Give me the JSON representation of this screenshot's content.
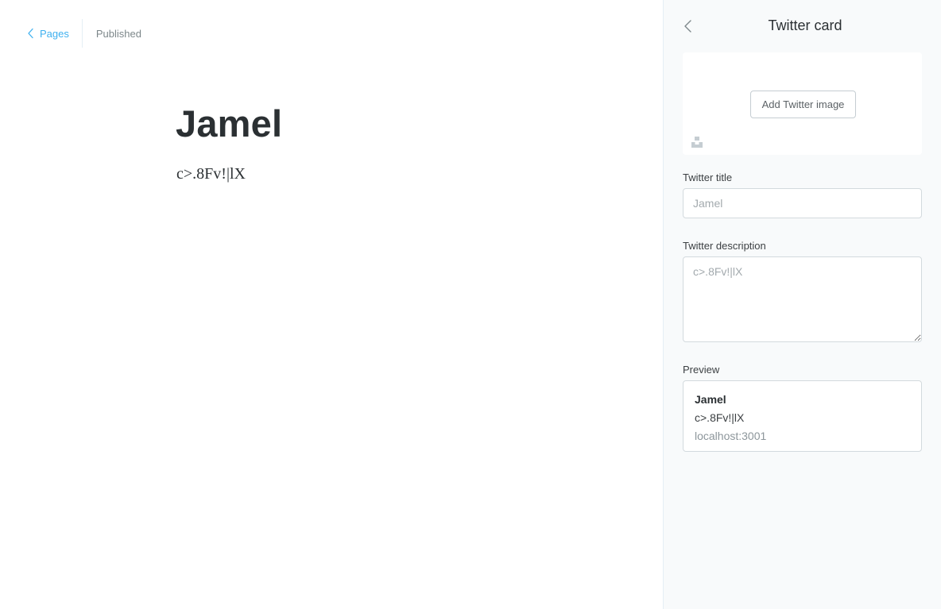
{
  "editor": {
    "back_label": "Pages",
    "status": "Published",
    "title": "Jamel",
    "body": "c>.8Fv!|lX"
  },
  "panel": {
    "title": "Twitter card",
    "add_image_label": "Add Twitter image",
    "twitter_title_label": "Twitter title",
    "twitter_title_placeholder": "Jamel",
    "twitter_description_label": "Twitter description",
    "twitter_description_placeholder": "c>.8Fv!|lX",
    "preview_label": "Preview",
    "preview": {
      "title": "Jamel",
      "description": "c>.8Fv!|lX",
      "url": "localhost:3001"
    }
  },
  "colors": {
    "accent": "#3eb0ef",
    "panel_bg": "#f8fafb",
    "border": "#d3dade",
    "text_dark": "#2b3033",
    "muted": "#7d878a"
  },
  "icons": {
    "editor_back": "chevron-left-icon",
    "panel_back": "chevron-left-icon",
    "unsplash": "unsplash-icon"
  }
}
